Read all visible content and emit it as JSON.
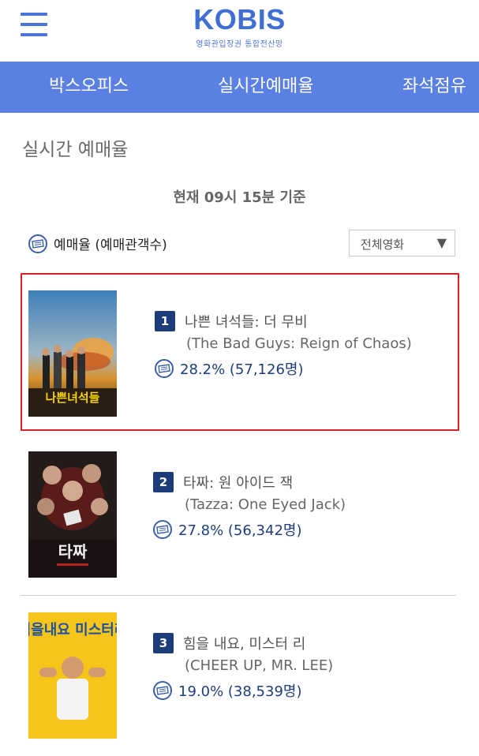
{
  "header": {
    "logo_main": "KOBIS",
    "logo_sub": "영화관입장권 통합전산망",
    "brand_color": "#3f6fd5"
  },
  "nav": {
    "tabs": [
      "박스오피스",
      "실시간예매율",
      "좌석점유"
    ]
  },
  "page": {
    "title": "실시간 예매율",
    "time_label": "현재 09시 15분  기준",
    "legend_label": "예매율 (예매관객수)",
    "filter_selected": "전체영화"
  },
  "movies": [
    {
      "rank": "1",
      "title_ko": "나쁜 녀석들: 더 무비",
      "title_en": "(The Bad Guys: Reign of Chaos)",
      "rate": "28.2% (57,126명)",
      "poster_text": "나쁜녀석들"
    },
    {
      "rank": "2",
      "title_ko": "타짜: 원 아이드 잭",
      "title_en": "(Tazza: One Eyed Jack)",
      "rate": "27.8% (56,342명)",
      "poster_text": "타짜"
    },
    {
      "rank": "3",
      "title_ko": "힘을 내요, 미스터 리",
      "title_en": "(CHEER UP, MR. LEE)",
      "rate": "19.0% (38,539명)",
      "poster_text": "힘을내요 미스터리"
    }
  ],
  "colors": {
    "nav_bg": "#5b80e3",
    "rank_bg": "#1d3d7a",
    "selected_border": "#d9232b"
  }
}
